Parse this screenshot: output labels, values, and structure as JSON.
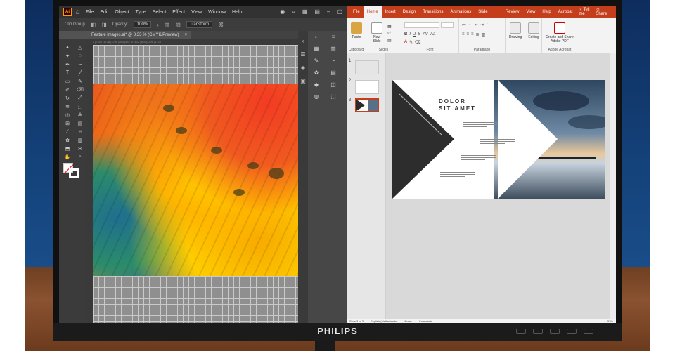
{
  "device": {
    "brand": "PHILIPS"
  },
  "illustrator": {
    "logo": "Ai",
    "menu": [
      "File",
      "Edit",
      "Object",
      "Type",
      "Select",
      "Effect",
      "View",
      "Window",
      "Help"
    ],
    "control_bar": {
      "selection": "Clip Group",
      "opacity_label": "Opacity:",
      "opacity_value": "100%",
      "transform_label": "Transform"
    },
    "document_tab": {
      "title": "Feature images.ai* @ 8.33 % (CMYK/Preview)"
    },
    "ruler_marks": "|2592   |2160   |1728   |1296   |864   |432   |0   |432   |864   |1296   |1728"
  },
  "powerpoint": {
    "tabs": [
      "File",
      "Home",
      "Insert",
      "Design",
      "Transitions",
      "Animations",
      "Slide Show",
      "Review",
      "View",
      "Help",
      "Acrobat"
    ],
    "active_tab": "Home",
    "tell_me": "Tell me",
    "share": "Share",
    "ribbon": {
      "paste": "Paste",
      "new_slide": "New Slide",
      "drawing": "Drawing",
      "editing": "Editing",
      "create_share": "Create and Share Adobe PDF",
      "groups": [
        "Clipboard",
        "Slides",
        "Font",
        "Paragraph",
        "Adobe Acrobat"
      ]
    },
    "thumbnails": [
      "1",
      "2",
      "3"
    ],
    "slide": {
      "title_line1": "DOLOR",
      "title_line2": "SIT AMET"
    },
    "status": {
      "slide": "Slide 3 of 3",
      "language": "English (Netherlands)",
      "notes": "Notes",
      "comments": "Comments",
      "zoom": "53%"
    }
  }
}
